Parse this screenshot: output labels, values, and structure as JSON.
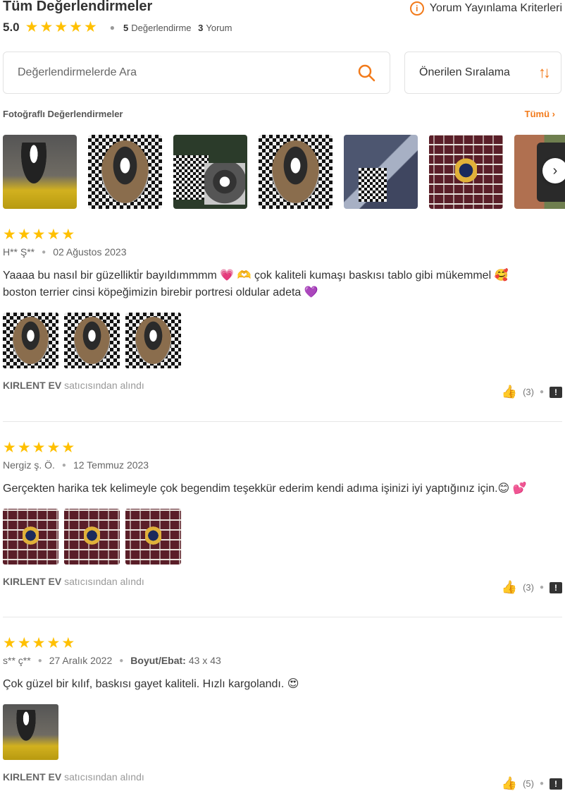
{
  "header": {
    "title": "Tüm Değerlendirmeler",
    "criteria_label": "Yorum Yayınlama Kriterleri",
    "score": "5.0",
    "rating_count": "5",
    "rating_label": "Değerlendirme",
    "comment_count": "3",
    "comment_label": "Yorum"
  },
  "search": {
    "placeholder": "Değerlendirmelerde Ara"
  },
  "sort": {
    "label": "Önerilen Sıralama"
  },
  "photos": {
    "label": "Fotoğraflı Değerlendirmeler",
    "all_label": "Tümü"
  },
  "reviews": [
    {
      "author": "H** Ş**",
      "date": "02 Ağustos 2023",
      "comment_line1": "Yaaaa bu nasıl bir güzellikti̇r bayıldımmmm 💗 🫶 çok kaliteli kumaşı baskısı tablo gibi mükemmel 🥰",
      "comment_line2": "boston terrier cinsi köpeğimizin birebir portresi oldular adeta 💜",
      "seller": "KIRLENT EV",
      "seller_suffix": "satıcısından alındı",
      "likes": "(3)"
    },
    {
      "author": "Nergiz ş. Ö.",
      "date": "12 Temmuz 2023",
      "comment_line1": "Gerçekten harika tek kelimeyle çok begendim teşekkür ederim kendi adıma işinizi iyi yaptığınız için.😊 💕",
      "seller": "KIRLENT EV",
      "seller_suffix": "satıcısından alındı",
      "likes": "(3)"
    },
    {
      "author": "s** ç**",
      "date": "27 Aralık 2022",
      "size_label": "Boyut/Ebat:",
      "size_value": "43 x 43",
      "comment_line1": "Çok güzel bir kılıf, baskısı gayet kaliteli. Hızlı kargolandı. 😍",
      "seller": "KIRLENT EV",
      "seller_suffix": "satıcısından alındı",
      "likes": "(5)"
    }
  ],
  "colors": {
    "accent": "#f27a1a",
    "star": "#ffc000"
  },
  "icons": [
    "info-icon",
    "star-icon",
    "search-icon",
    "sort-icon",
    "chevron-right-icon",
    "thumbs-up-icon",
    "report-icon"
  ]
}
